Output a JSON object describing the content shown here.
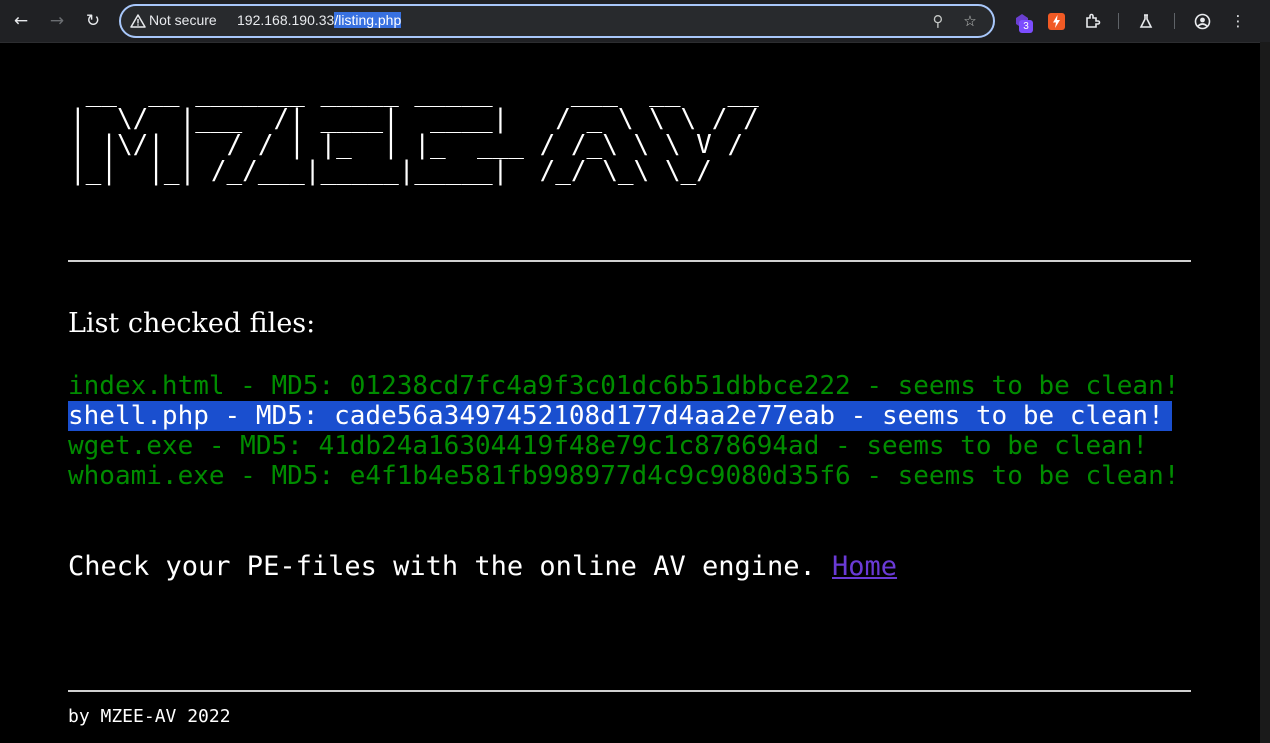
{
  "browser": {
    "security_label": "Not secure",
    "url_host": "192.168.190.33",
    "url_path": "/listing.php",
    "extension_badge": "3"
  },
  "page": {
    "banner": " __  __ _______ _____ _____     ___  __   __\n|  \\/  |___  /| ____|  ____|   / _ \\ \\ \\ / /\n| |\\/| |  / / | |_  | |_  ___ / /_\\ \\ \\ V / \n|_|  |_| /_/___|_____|_____|  /_/ \\_\\ \\_/  ",
    "heading": "List checked files:",
    "files": [
      {
        "text": "index.html - MD5: 01238cd7fc4a9f3c01dc6b51dbbce222 - seems to be clean!"
      },
      {
        "text": "shell.php - MD5: cade56a3497452108d177d4aa2e77eab - seems to be clean!"
      },
      {
        "text": "wget.exe - MD5: 41db24a16304419f48e79c1c878694ad - seems to be clean!"
      },
      {
        "text": "whoami.exe - MD5: e4f1b4e581fb998977d4c9c9080d35f6 - seems to be clean!"
      }
    ],
    "check_text": "Check your PE-files with the online AV engine. ",
    "home_link": "Home",
    "credit": "by MZEE-AV 2022"
  }
}
